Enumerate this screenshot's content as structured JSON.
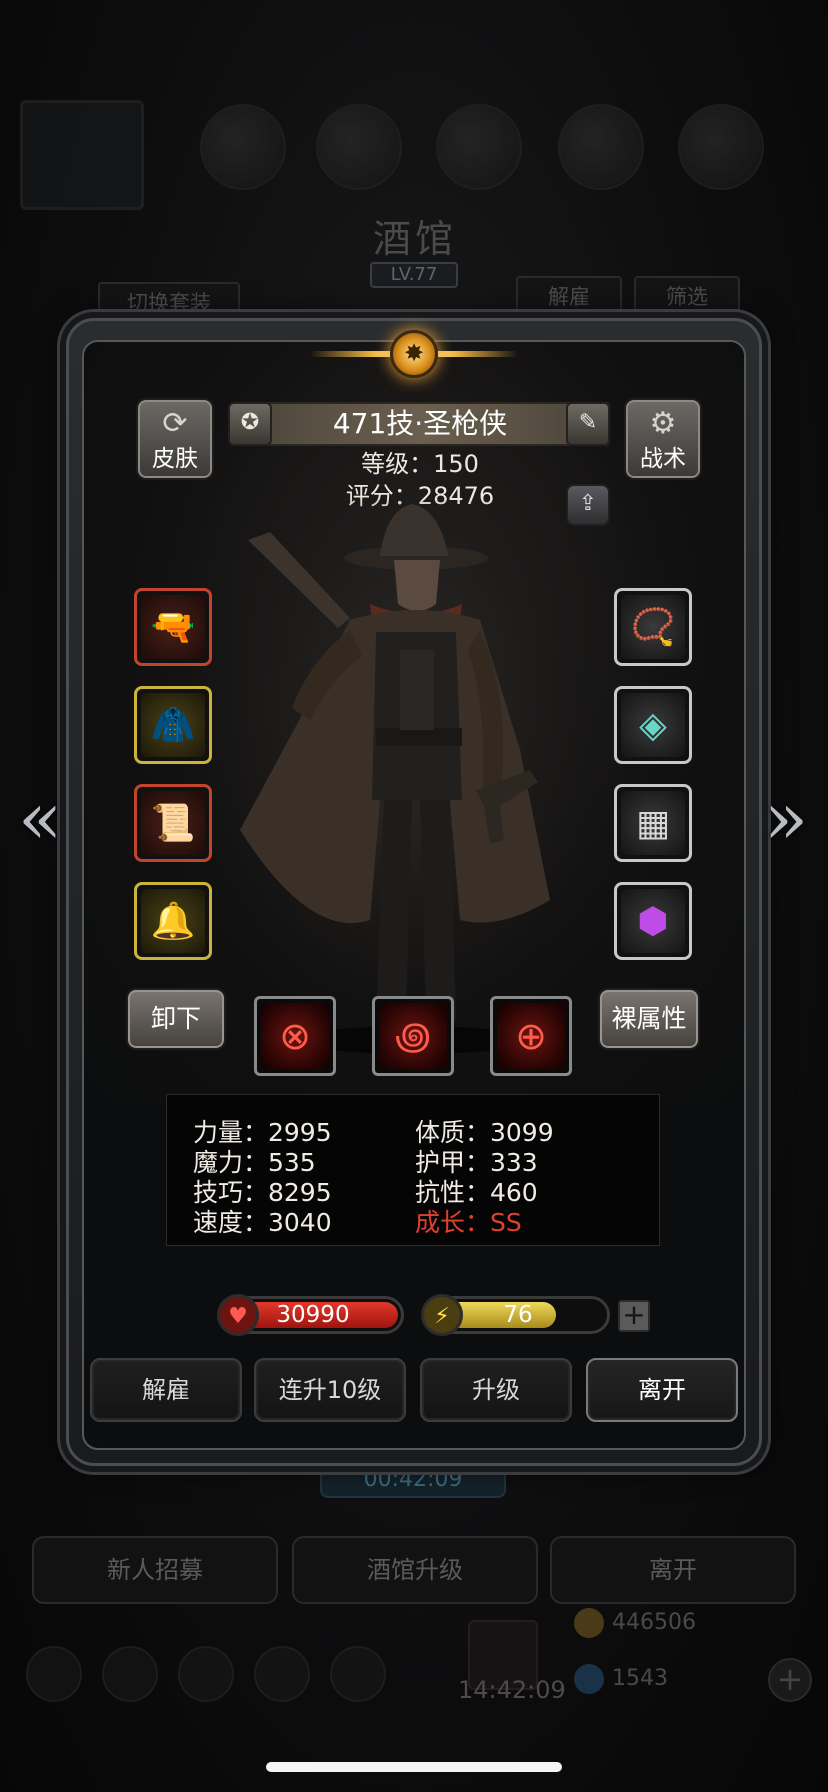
{
  "background": {
    "title": "酒馆",
    "level": "LV.77",
    "switch_outfit": "切换套装",
    "dismiss": "解雇",
    "filter": "筛选",
    "timer": "00:42:09",
    "recruit": "新人招募",
    "upgrade_tavern": "酒馆升级",
    "leave": "离开",
    "gold": "446506",
    "gems": "1543",
    "clock": "14:42:09"
  },
  "hero": {
    "name": "471技·圣枪侠",
    "level_text": "等级：150",
    "score_text": "评分：28476"
  },
  "buttons": {
    "skin": "皮肤",
    "tactics": "战术",
    "unequip": "卸下",
    "base_attributes": "裸属性"
  },
  "icons": {
    "skin": "refresh-icon",
    "tactics": "gear-icon",
    "medal": "medal-icon",
    "edit": "edit-icon",
    "share": "share-icon"
  },
  "stats": {
    "strength": "力量：2995",
    "constitution": "体质：3099",
    "magic": "魔力：535",
    "armor": "护甲：333",
    "skill": "技巧：8295",
    "resistance": "抗性：460",
    "speed": "速度：3040",
    "growth": "成长：SS"
  },
  "bars": {
    "hp": "30990",
    "energy": "76",
    "energy_fraction": 0.72,
    "plus": "+"
  },
  "actions": {
    "dismiss": "解雇",
    "level_up_10": "连升10级",
    "level_up": "升级",
    "leave": "离开"
  },
  "colors": {
    "growth": "#e0402c",
    "hp": "#c4201a",
    "energy": "#d8c43a",
    "slot_red": "#c4432b",
    "slot_yellow": "#cbb43a",
    "slot_white": "#c8c8c8"
  }
}
